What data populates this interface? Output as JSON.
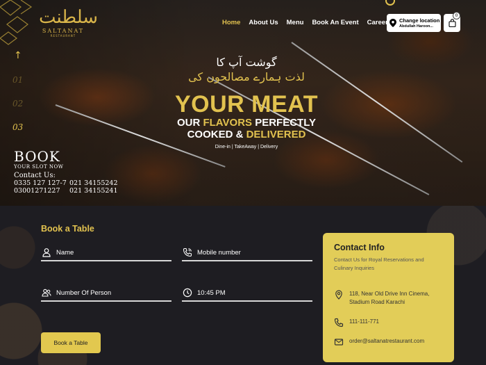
{
  "brand": {
    "logo_mark": "سلطنت",
    "logo_text": "SALTANAT",
    "logo_sub": "RESTAURANT"
  },
  "nav": {
    "items": [
      {
        "label": "Home",
        "active": true
      },
      {
        "label": "About Us",
        "active": false
      },
      {
        "label": "Menu",
        "active": false
      },
      {
        "label": "Book An Event",
        "active": false
      },
      {
        "label": "Career",
        "active": false
      }
    ]
  },
  "location": {
    "title": "Change location",
    "value": "Abdullah Haroon..."
  },
  "cart": {
    "count": "0"
  },
  "slider": {
    "up_arrow": "↑",
    "numbers": [
      "01",
      "02",
      "03"
    ],
    "active_index": 2
  },
  "booking_banner": {
    "book": "BOOK",
    "slot": "YOUR SLOT NOW",
    "contact_label": "Contact Us:",
    "phones": [
      "0335 127 127-7",
      "021 34155242",
      "03001271227",
      "021 34155241"
    ]
  },
  "hero": {
    "urdu_line1": "گوشت آپ کا",
    "urdu_line2": "لذت ہمارے مصالحوں کی",
    "headline": "YOUR MEAT",
    "line3_pre": "OUR ",
    "line3_hl": "FLAVORS",
    "line3_post": " PERFECTLY",
    "line4_pre": "COOKED & ",
    "line4_hl": "DELIVERED",
    "modes": "Dine-in | TakeAway | Delivery"
  },
  "form": {
    "title": "Book a Table",
    "name_label": "Name",
    "mobile_label": "Mobile number",
    "persons_label": "Number Of Person",
    "time_value": "10:45 PM",
    "submit_label": "Book a Table"
  },
  "contact_info": {
    "title": "Contact Info",
    "subtitle": "Contact Us for Royal Reservations and Culinary Inquiries",
    "address": "118, Near Old Drive Inn Cinema, Stadium Road Karachi",
    "phone": "111-111-771",
    "email": "order@saltanatrestaurant.com"
  },
  "colors": {
    "accent": "#e2c24f",
    "card": "#e2cd58",
    "background": "#1e1d22"
  }
}
